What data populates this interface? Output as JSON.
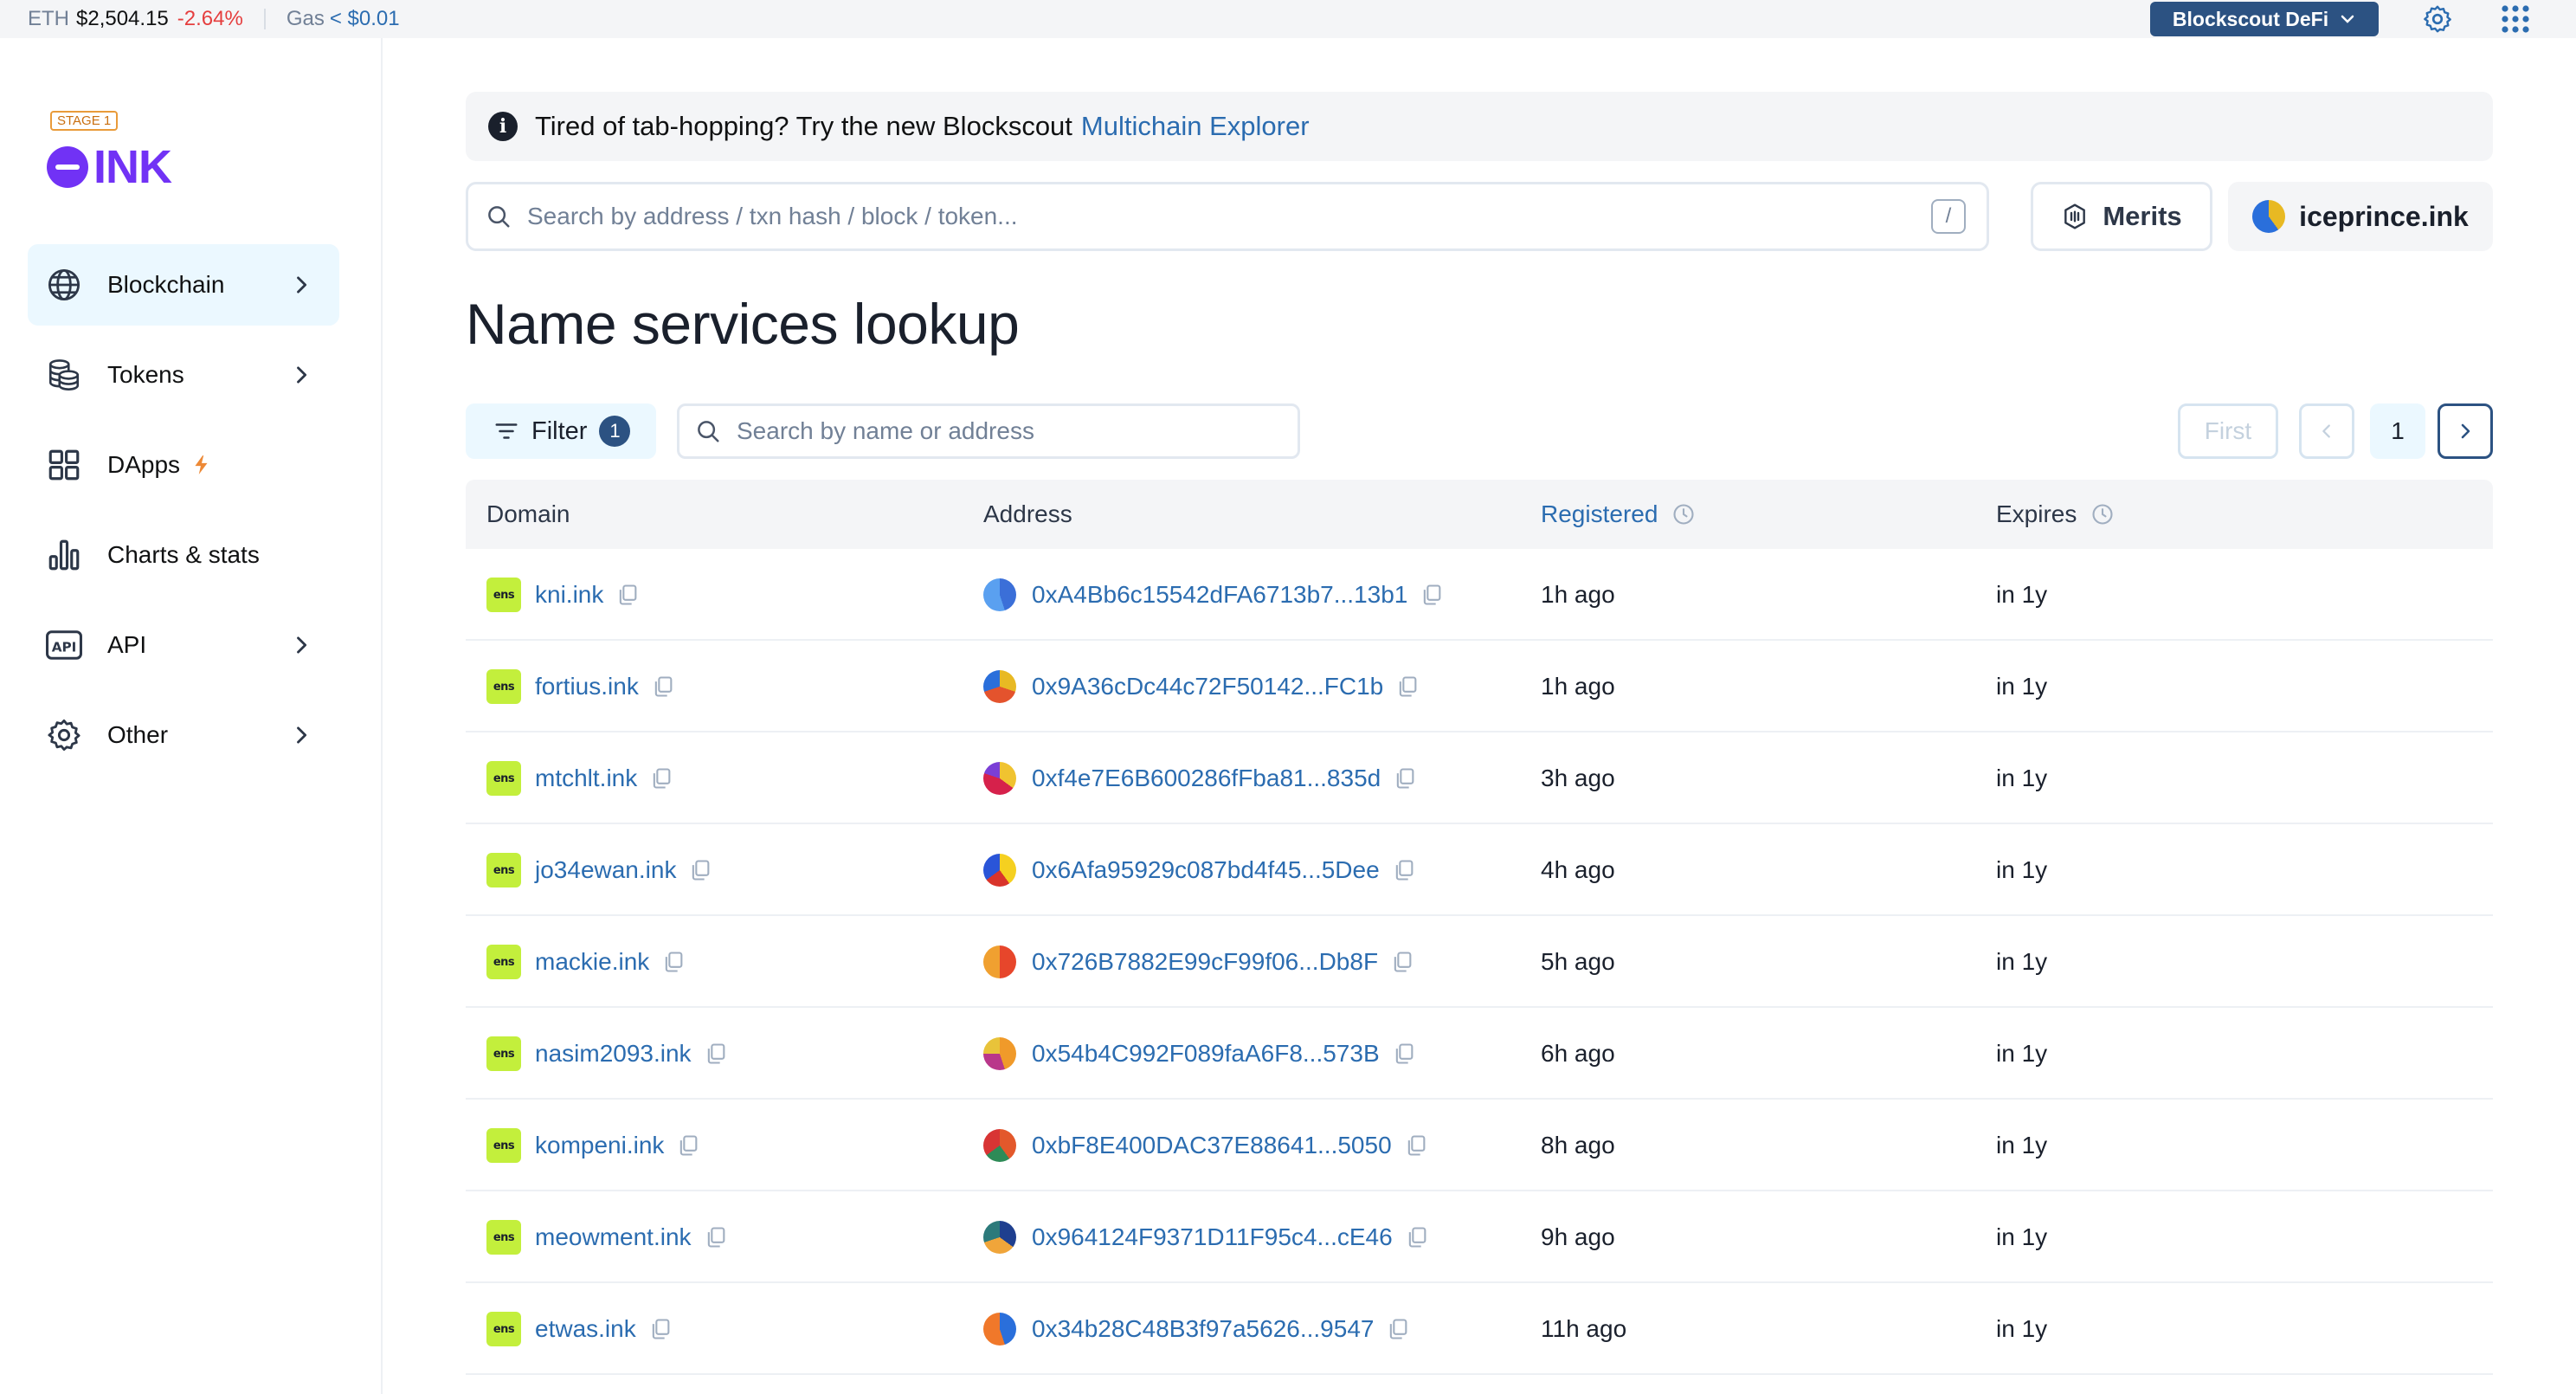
{
  "topbar": {
    "eth_label": "ETH",
    "eth_price": "$2,504.15",
    "eth_change": "-2.64%",
    "gas_label": "Gas",
    "gas_value": "< $0.01",
    "defi_label": "Blockscout DeFi"
  },
  "sidebar": {
    "stage_badge": "STAGE 1",
    "logo_text": "INK",
    "items": [
      {
        "label": "Blockchain",
        "icon": "globe-icon",
        "active": true
      },
      {
        "label": "Tokens",
        "icon": "coins-icon"
      },
      {
        "label": "DApps",
        "icon": "apps-grid-icon"
      },
      {
        "label": "Charts & stats",
        "icon": "bar-chart-icon"
      },
      {
        "label": "API",
        "icon": "api-icon"
      },
      {
        "label": "Other",
        "icon": "gear-icon"
      }
    ]
  },
  "banner": {
    "text": "Tired of tab-hopping? Try the new Blockscout",
    "link": "Multichain Explorer"
  },
  "search": {
    "placeholder": "Search by address / txn hash / block / token...",
    "shortcut": "/"
  },
  "header_buttons": {
    "merits": "Merits",
    "account": "iceprince.ink"
  },
  "page": {
    "title": "Name services lookup"
  },
  "filter": {
    "label": "Filter",
    "count": "1",
    "search_placeholder": "Search by name or address"
  },
  "pagination": {
    "first": "First",
    "current": "1"
  },
  "table": {
    "columns": [
      "Domain",
      "Address",
      "Registered",
      "Expires"
    ],
    "rows": [
      {
        "domain": "kni.ink",
        "address": "0xA4Bb6c15542dFA6713b7...13b1",
        "registered": "1h ago",
        "expires": "in 1y"
      },
      {
        "domain": "fortius.ink",
        "address": "0x9A36cDc44c72F50142...FC1b",
        "registered": "1h ago",
        "expires": "in 1y"
      },
      {
        "domain": "mtchlt.ink",
        "address": "0xf4e7E6B600286fFba81...835d",
        "registered": "3h ago",
        "expires": "in 1y"
      },
      {
        "domain": "jo34ewan.ink",
        "address": "0x6Afa95929c087bd4f45...5Dee",
        "registered": "4h ago",
        "expires": "in 1y"
      },
      {
        "domain": "mackie.ink",
        "address": "0x726B7882E99cF99f06...Db8F",
        "registered": "5h ago",
        "expires": "in 1y"
      },
      {
        "domain": "nasim2093.ink",
        "address": "0x54b4C992F089faA6F8...573B",
        "registered": "6h ago",
        "expires": "in 1y"
      },
      {
        "domain": "kompeni.ink",
        "address": "0xbF8E400DAC37E88641...5050",
        "registered": "8h ago",
        "expires": "in 1y"
      },
      {
        "domain": "meowment.ink",
        "address": "0x964124F9371D11F95c4...cE46",
        "registered": "9h ago",
        "expires": "in 1y"
      },
      {
        "domain": "etwas.ink",
        "address": "0x34b28C48B3f97a5626...9547",
        "registered": "11h ago",
        "expires": "in 1y"
      }
    ]
  },
  "colors": {
    "accent": "#2b6cb0",
    "brand": "#7132f5",
    "negative": "#e53e3e",
    "ens_badge": "#c3ef3c"
  }
}
